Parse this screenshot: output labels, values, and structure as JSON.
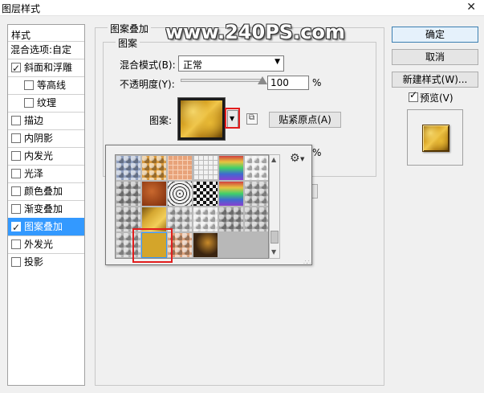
{
  "window": {
    "title": "图层样式",
    "close_glyph": "✕"
  },
  "watermark": "www.240PS.com",
  "style_list": {
    "header": "样式",
    "blend_options": "混合选项:自定",
    "items": [
      {
        "label": "斜面和浮雕",
        "checked": true,
        "indent": false,
        "selected": false
      },
      {
        "label": "等高线",
        "checked": false,
        "indent": true,
        "selected": false
      },
      {
        "label": "纹理",
        "checked": false,
        "indent": true,
        "selected": false
      },
      {
        "label": "描边",
        "checked": false,
        "indent": false,
        "selected": false
      },
      {
        "label": "内阴影",
        "checked": false,
        "indent": false,
        "selected": false
      },
      {
        "label": "内发光",
        "checked": false,
        "indent": false,
        "selected": false
      },
      {
        "label": "光泽",
        "checked": false,
        "indent": false,
        "selected": false
      },
      {
        "label": "颜色叠加",
        "checked": false,
        "indent": false,
        "selected": false
      },
      {
        "label": "渐变叠加",
        "checked": false,
        "indent": false,
        "selected": false
      },
      {
        "label": "图案叠加",
        "checked": true,
        "indent": false,
        "selected": true
      },
      {
        "label": "外发光",
        "checked": false,
        "indent": false,
        "selected": false
      },
      {
        "label": "投影",
        "checked": false,
        "indent": false,
        "selected": false
      }
    ]
  },
  "pattern_overlay": {
    "group_title": "图案叠加",
    "sub_group_title": "图案",
    "blend_mode_label": "混合模式(B):",
    "blend_mode_value": "正常",
    "opacity_label": "不透明度(Y):",
    "opacity_value": "100",
    "opacity_percent": 100,
    "percent_sign": "%",
    "scale_percent_sign": "%",
    "pattern_label": "图案:",
    "snap_origin_button": "贴紧原点(A)"
  },
  "buttons": {
    "ok": "确定",
    "cancel": "取消",
    "new_style": "新建样式(W)...",
    "preview_label": "预览(V)",
    "preview_checked": true
  },
  "picker": {
    "gear_icon": "gear-icon",
    "tiles": [
      [
        "#8f9fbf",
        "#d99a3e",
        "#e8a37a",
        "#f2f2f2",
        "#8a3fd0",
        "#e8e8e8"
      ],
      [
        "#9a9a9a",
        "#a8461c",
        "#dddddd",
        "#333333",
        "#7a6ad0",
        "#b0b0b0"
      ],
      [
        "#a8a8a8",
        "#c9a24a",
        "#c0c0c0",
        "#e0e0e0",
        "#9a9a9a",
        "#aaaaaa"
      ],
      [
        "#b5b5b5",
        "#d4a52a",
        "#d9a07a",
        "#3a2410",
        "",
        ""
      ]
    ],
    "selected_index": 19
  },
  "colors": {
    "selection": "#3399ff",
    "highlight_red": "#e21d1d"
  }
}
